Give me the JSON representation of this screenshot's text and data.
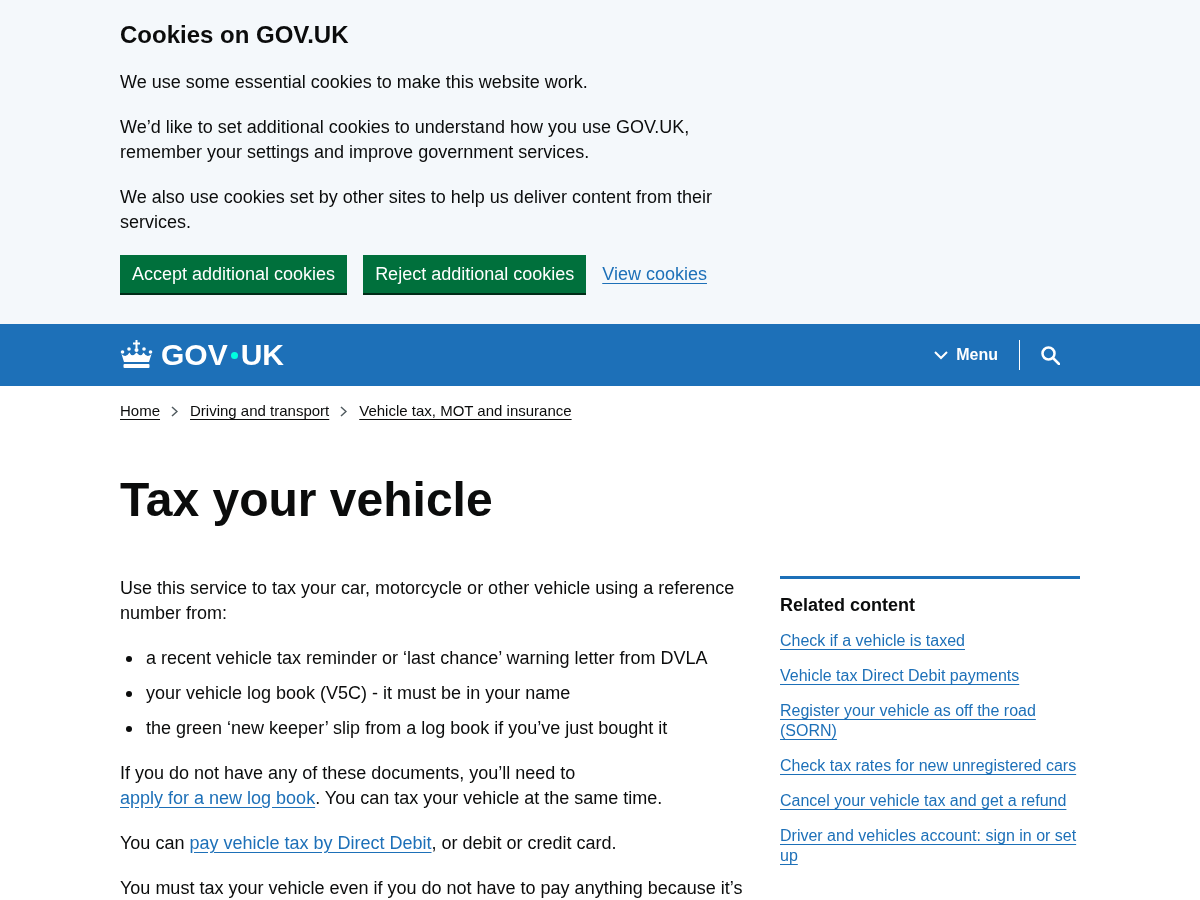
{
  "cookie_banner": {
    "title": "Cookies on GOV.UK",
    "paragraphs": [
      "We use some essential cookies to make this website work.",
      "We’d like to set additional cookies to understand how you use GOV.UK, remember your settings and improve government services.",
      "We also use cookies set by other sites to help us deliver content from their services."
    ],
    "buttons": [
      "Accept additional cookies",
      "Reject additional cookies"
    ],
    "link": "View cookies"
  },
  "header": {
    "logo_words": [
      "GOV",
      "UK"
    ],
    "menu_button": "Menu"
  },
  "breadcrumbs": [
    "Home",
    "Driving and transport",
    "Vehicle tax, MOT and insurance"
  ],
  "title": "Tax your vehicle",
  "content": [
    {
      "kind": "paragraph",
      "parts": [
        {
          "kind": "text",
          "text": "Use this service to tax your car, motorcycle or other vehicle using a reference number from:"
        }
      ]
    },
    {
      "kind": "bullets",
      "items": [
        "a recent vehicle tax reminder or ‘last chance’ warning letter from DVLA",
        "your vehicle log book (V5C) - it must be in your name",
        "the green ‘new keeper’ slip from a log book if you’ve just bought it"
      ]
    },
    {
      "kind": "paragraph",
      "parts": [
        {
          "kind": "text",
          "text": "If you do not have any of these documents, you’ll need to "
        },
        {
          "kind": "link",
          "text": "apply for a new log book"
        },
        {
          "kind": "text",
          "text": ". You can tax your vehicle at the same time."
        }
      ]
    },
    {
      "kind": "paragraph",
      "parts": [
        {
          "kind": "text",
          "text": "You can "
        },
        {
          "kind": "link",
          "text": "pay vehicle tax by Direct Debit"
        },
        {
          "kind": "text",
          "text": ", or debit or credit card."
        }
      ]
    },
    {
      "kind": "paragraph",
      "parts": [
        {
          "kind": "text",
          "text": "You must tax your vehicle even if you do not have to pay anything because it’s"
        }
      ]
    }
  ],
  "related": {
    "title": "Related content",
    "links": [
      "Check if a vehicle is taxed",
      "Vehicle tax Direct Debit payments",
      "Register your vehicle as off the road (SORN)",
      "Check tax rates for new unregistered cars",
      "Cancel your vehicle tax and get a refund",
      "Driver and vehicles account: sign in or set up"
    ]
  }
}
